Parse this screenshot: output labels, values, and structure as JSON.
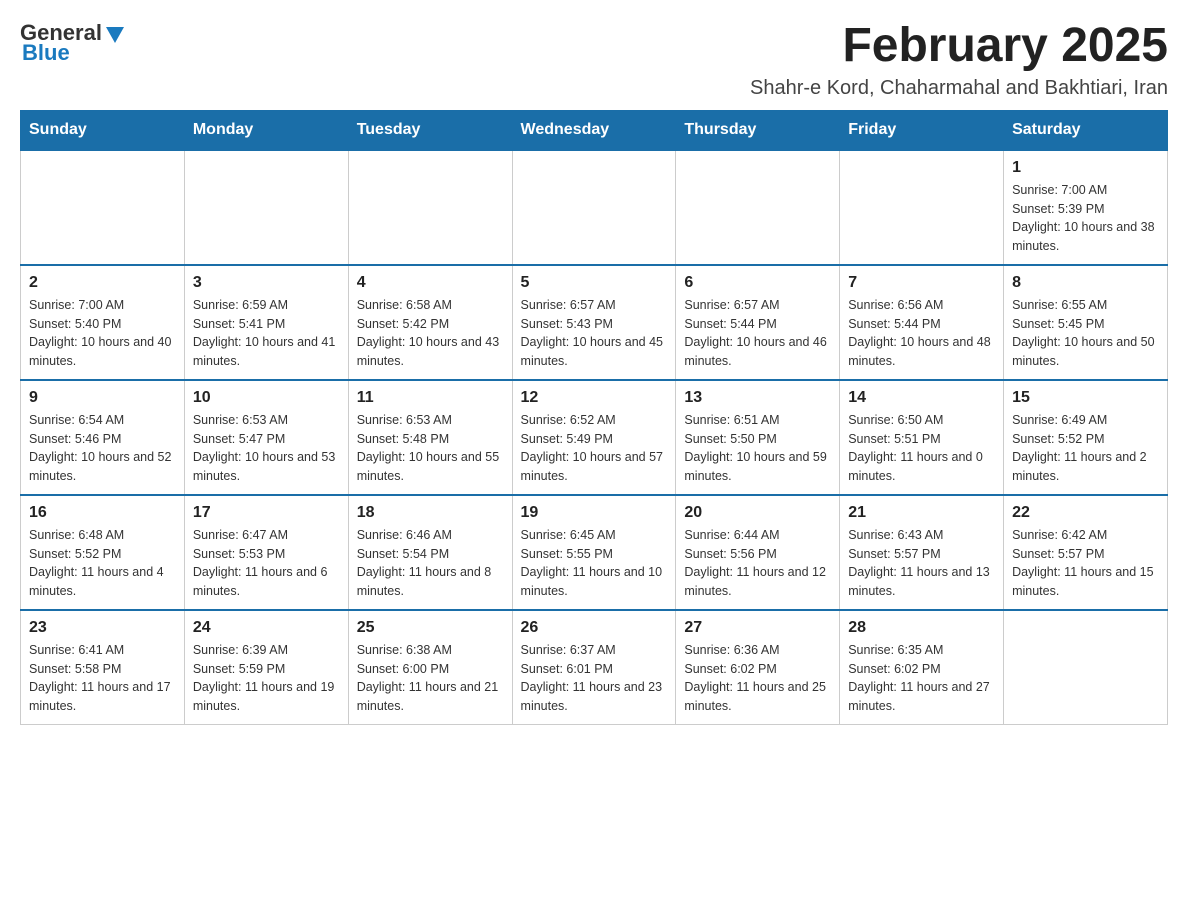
{
  "header": {
    "logo": {
      "general": "General",
      "blue": "Blue"
    },
    "title": "February 2025",
    "subtitle": "Shahr-e Kord, Chaharmahal and Bakhtiari, Iran"
  },
  "weekdays": [
    "Sunday",
    "Monday",
    "Tuesday",
    "Wednesday",
    "Thursday",
    "Friday",
    "Saturday"
  ],
  "weeks": [
    [
      {
        "day": "",
        "info": ""
      },
      {
        "day": "",
        "info": ""
      },
      {
        "day": "",
        "info": ""
      },
      {
        "day": "",
        "info": ""
      },
      {
        "day": "",
        "info": ""
      },
      {
        "day": "",
        "info": ""
      },
      {
        "day": "1",
        "info": "Sunrise: 7:00 AM\nSunset: 5:39 PM\nDaylight: 10 hours and 38 minutes."
      }
    ],
    [
      {
        "day": "2",
        "info": "Sunrise: 7:00 AM\nSunset: 5:40 PM\nDaylight: 10 hours and 40 minutes."
      },
      {
        "day": "3",
        "info": "Sunrise: 6:59 AM\nSunset: 5:41 PM\nDaylight: 10 hours and 41 minutes."
      },
      {
        "day": "4",
        "info": "Sunrise: 6:58 AM\nSunset: 5:42 PM\nDaylight: 10 hours and 43 minutes."
      },
      {
        "day": "5",
        "info": "Sunrise: 6:57 AM\nSunset: 5:43 PM\nDaylight: 10 hours and 45 minutes."
      },
      {
        "day": "6",
        "info": "Sunrise: 6:57 AM\nSunset: 5:44 PM\nDaylight: 10 hours and 46 minutes."
      },
      {
        "day": "7",
        "info": "Sunrise: 6:56 AM\nSunset: 5:44 PM\nDaylight: 10 hours and 48 minutes."
      },
      {
        "day": "8",
        "info": "Sunrise: 6:55 AM\nSunset: 5:45 PM\nDaylight: 10 hours and 50 minutes."
      }
    ],
    [
      {
        "day": "9",
        "info": "Sunrise: 6:54 AM\nSunset: 5:46 PM\nDaylight: 10 hours and 52 minutes."
      },
      {
        "day": "10",
        "info": "Sunrise: 6:53 AM\nSunset: 5:47 PM\nDaylight: 10 hours and 53 minutes."
      },
      {
        "day": "11",
        "info": "Sunrise: 6:53 AM\nSunset: 5:48 PM\nDaylight: 10 hours and 55 minutes."
      },
      {
        "day": "12",
        "info": "Sunrise: 6:52 AM\nSunset: 5:49 PM\nDaylight: 10 hours and 57 minutes."
      },
      {
        "day": "13",
        "info": "Sunrise: 6:51 AM\nSunset: 5:50 PM\nDaylight: 10 hours and 59 minutes."
      },
      {
        "day": "14",
        "info": "Sunrise: 6:50 AM\nSunset: 5:51 PM\nDaylight: 11 hours and 0 minutes."
      },
      {
        "day": "15",
        "info": "Sunrise: 6:49 AM\nSunset: 5:52 PM\nDaylight: 11 hours and 2 minutes."
      }
    ],
    [
      {
        "day": "16",
        "info": "Sunrise: 6:48 AM\nSunset: 5:52 PM\nDaylight: 11 hours and 4 minutes."
      },
      {
        "day": "17",
        "info": "Sunrise: 6:47 AM\nSunset: 5:53 PM\nDaylight: 11 hours and 6 minutes."
      },
      {
        "day": "18",
        "info": "Sunrise: 6:46 AM\nSunset: 5:54 PM\nDaylight: 11 hours and 8 minutes."
      },
      {
        "day": "19",
        "info": "Sunrise: 6:45 AM\nSunset: 5:55 PM\nDaylight: 11 hours and 10 minutes."
      },
      {
        "day": "20",
        "info": "Sunrise: 6:44 AM\nSunset: 5:56 PM\nDaylight: 11 hours and 12 minutes."
      },
      {
        "day": "21",
        "info": "Sunrise: 6:43 AM\nSunset: 5:57 PM\nDaylight: 11 hours and 13 minutes."
      },
      {
        "day": "22",
        "info": "Sunrise: 6:42 AM\nSunset: 5:57 PM\nDaylight: 11 hours and 15 minutes."
      }
    ],
    [
      {
        "day": "23",
        "info": "Sunrise: 6:41 AM\nSunset: 5:58 PM\nDaylight: 11 hours and 17 minutes."
      },
      {
        "day": "24",
        "info": "Sunrise: 6:39 AM\nSunset: 5:59 PM\nDaylight: 11 hours and 19 minutes."
      },
      {
        "day": "25",
        "info": "Sunrise: 6:38 AM\nSunset: 6:00 PM\nDaylight: 11 hours and 21 minutes."
      },
      {
        "day": "26",
        "info": "Sunrise: 6:37 AM\nSunset: 6:01 PM\nDaylight: 11 hours and 23 minutes."
      },
      {
        "day": "27",
        "info": "Sunrise: 6:36 AM\nSunset: 6:02 PM\nDaylight: 11 hours and 25 minutes."
      },
      {
        "day": "28",
        "info": "Sunrise: 6:35 AM\nSunset: 6:02 PM\nDaylight: 11 hours and 27 minutes."
      },
      {
        "day": "",
        "info": ""
      }
    ]
  ]
}
